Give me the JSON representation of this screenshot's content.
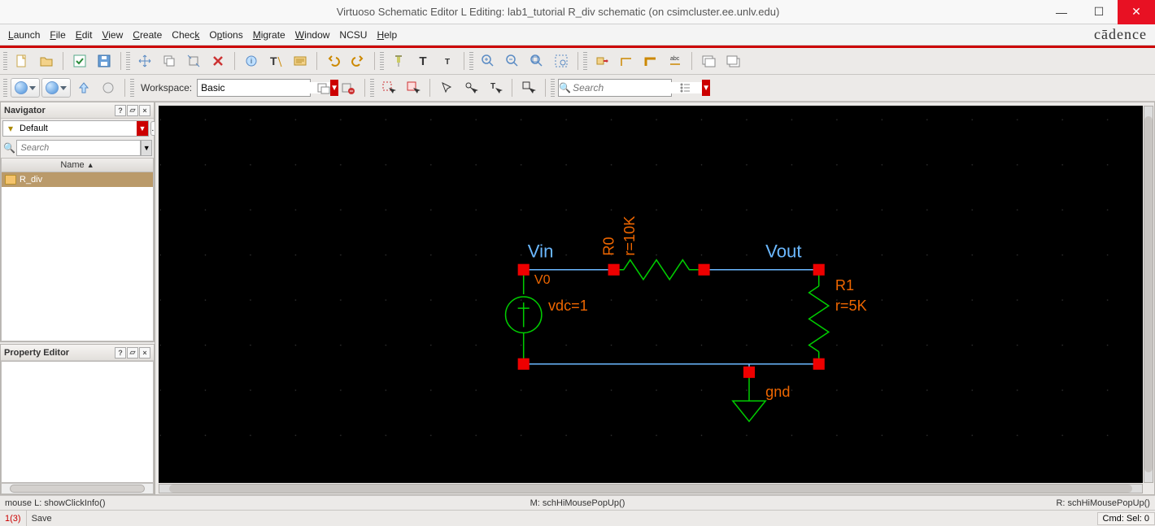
{
  "title": "Virtuoso Schematic Editor L Editing: lab1_tutorial R_div schematic (on csimcluster.ee.unlv.edu)",
  "brand": "cādence",
  "menus": {
    "launch": "Launch",
    "file": "File",
    "edit": "Edit",
    "view": "View",
    "create": "Create",
    "check": "Check",
    "options": "Options",
    "migrate": "Migrate",
    "window": "Window",
    "ncsu": "NCSU",
    "help": "Help"
  },
  "workspace": {
    "label": "Workspace:",
    "value": "Basic"
  },
  "search": {
    "placeholder": "Search"
  },
  "navigator": {
    "title": "Navigator",
    "filter_default": "Default",
    "search_placeholder": "Search",
    "column": "Name",
    "items": [
      {
        "label": "R_div"
      }
    ]
  },
  "property_editor": {
    "title": "Property Editor"
  },
  "schematic": {
    "labels": {
      "vin": "Vin",
      "vout": "Vout",
      "v0": "V0",
      "vdc": "vdc=1",
      "r0": "R0",
      "r0val": "r=10K",
      "r1": "R1",
      "r1val": "r=5K",
      "gnd": "gnd"
    }
  },
  "status": {
    "mouseL": "mouse L: showClickInfo()",
    "mouseM": "M: schHiMousePopUp()",
    "mouseR": "R: schHiMousePopUp()",
    "count": "1(3)",
    "action": "Save",
    "cmd": "Cmd: Sel: 0"
  }
}
